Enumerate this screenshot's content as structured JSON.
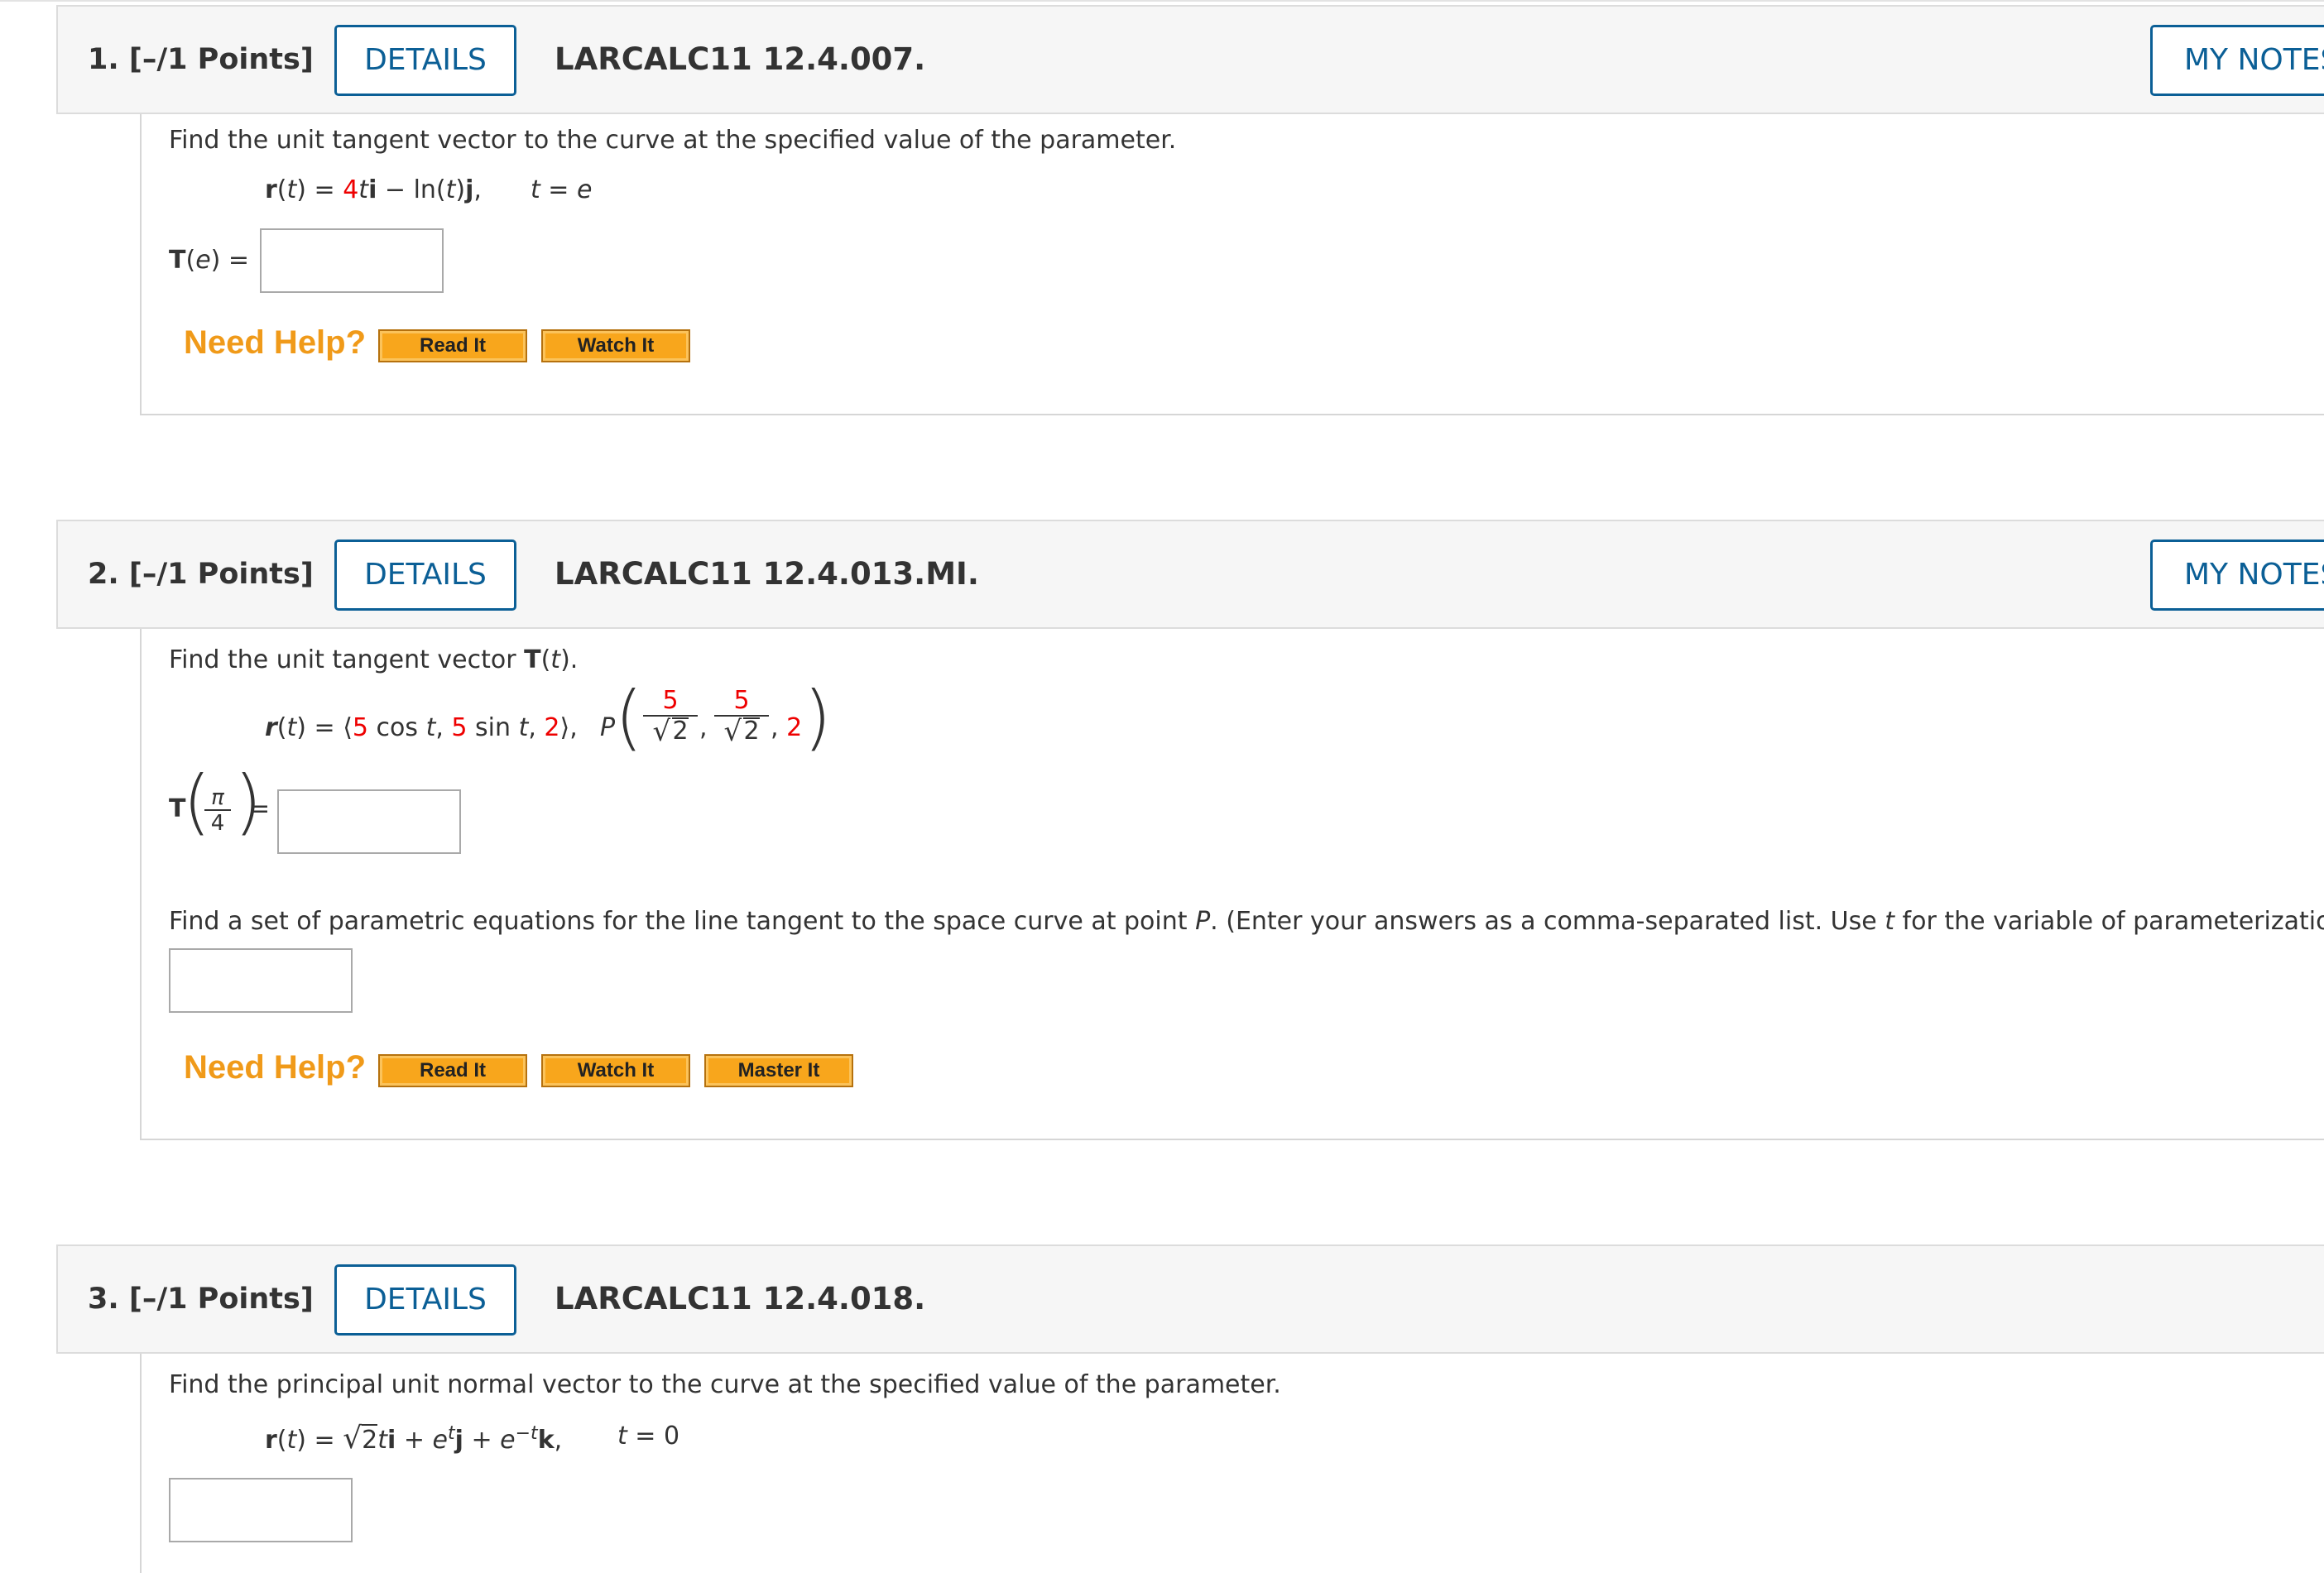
{
  "questions": [
    {
      "number": "1.",
      "points": "[–/1 Points]",
      "details_label": "DETAILS",
      "id": "LARCALC11 12.4.007.",
      "mynotes_label": "MY NOTES",
      "prompt": "Find the unit tangent vector to the curve at the specified value of the parameter.",
      "eq": {
        "r": "r",
        "open": "(",
        "t": "t",
        "close_eq": ") = ",
        "c1": "4",
        "t2": "t",
        "i": "i",
        "mid": " − ln(",
        "t3": "t",
        "close2": ")",
        "j": "j",
        "comma": ",",
        "tvar": "t",
        "equals_e": " = ",
        "evar": "e"
      },
      "answer_label": {
        "T": "T",
        "open": "(",
        "e": "e",
        "close": ") ="
      },
      "need_help": "Need Help?",
      "help_buttons": [
        "Read It",
        "Watch It"
      ]
    },
    {
      "number": "2.",
      "points": "[–/1 Points]",
      "details_label": "DETAILS",
      "id": "LARCALC11 12.4.013.MI.",
      "mynotes_label": "MY NOTES",
      "prompt_pre": "Find the unit tangent vector ",
      "prompt_T": "T",
      "prompt_open": "(",
      "prompt_t": "t",
      "prompt_close": ").",
      "eq": {
        "r": "r",
        "open": "(",
        "t": "t",
        "close_eq": ") = ",
        "lang": "⟨",
        "c1": "5",
        "cos": " cos ",
        "t1": "t",
        "comma1": ", ",
        "c2": "5",
        "sin": " sin ",
        "t2": "t",
        "comma2": ", ",
        "c3": "2",
        "rang": "⟩",
        "comma3": ",",
        "P": "P",
        "f1_num": "5",
        "f2_num": "5",
        "den": "2",
        "last": "2"
      },
      "answer_label": {
        "T": "T",
        "pi": "π",
        "four": "4",
        "eq": "="
      },
      "prompt2_a": "Find a set of parametric equations for the line tangent to the space curve at point ",
      "prompt2_P": "P",
      "prompt2_b": ". (Enter your answers as a comma-separated list. Use ",
      "prompt2_t": "t",
      "prompt2_c": " for the variable of parameterization.)",
      "need_help": "Need Help?",
      "help_buttons": [
        "Read It",
        "Watch It",
        "Master It"
      ]
    },
    {
      "number": "3.",
      "points": "[–/1 Points]",
      "details_label": "DETAILS",
      "id": "LARCALC11 12.4.018.",
      "prompt": "Find the principal unit normal vector to the curve at the specified value of the parameter.",
      "eq": {
        "r": "r",
        "open": "(",
        "t": "t",
        "close_eq": ") = ",
        "rad": "2",
        "t1": "t",
        "i": "i",
        "plus1": " + ",
        "e1": "e",
        "sup1": "t",
        "j": "j",
        "plus2": " + ",
        "e2": "e",
        "sup2": "−t",
        "k": "k",
        "comma": ",",
        "tvar": "t",
        "eq0": " = 0"
      }
    }
  ],
  "colors": {
    "link_blue": "#0b5f96",
    "header_bg": "#f6f6f6",
    "need_help_orange": "#f09a19",
    "help_button": "#f8a61c",
    "value_red": "#ee0000"
  }
}
